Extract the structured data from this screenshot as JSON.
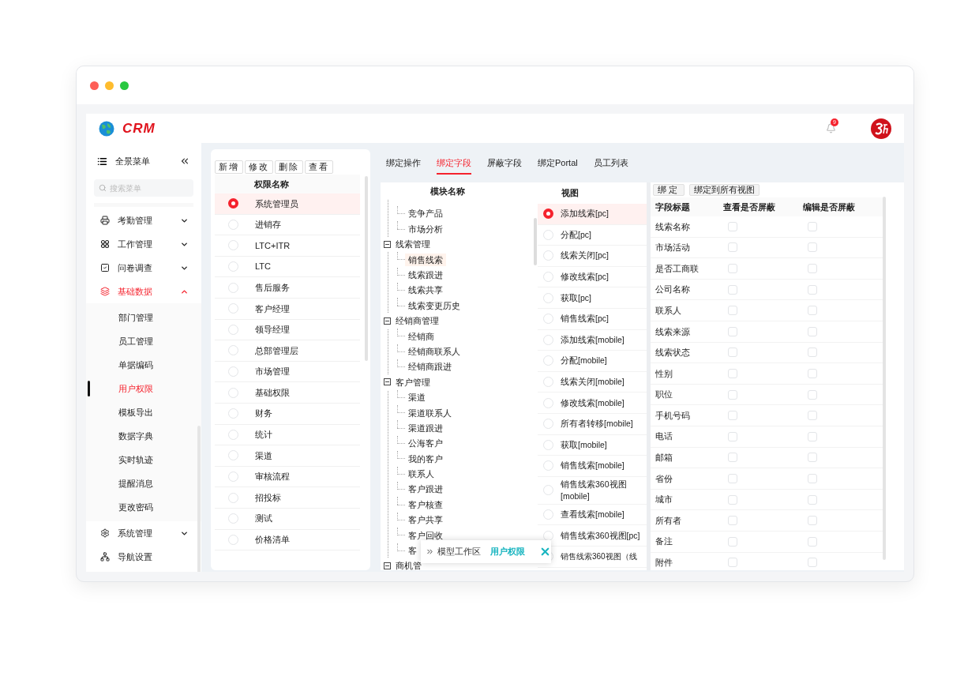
{
  "app": {
    "logo": "CRM",
    "notification_count": "9"
  },
  "sidebar": {
    "title": "全景菜单",
    "search_placeholder": "搜索菜单",
    "items": [
      {
        "label": "考勤管理",
        "selected": false,
        "expanded": false
      },
      {
        "label": "工作管理",
        "selected": false,
        "expanded": false
      },
      {
        "label": "问卷调查",
        "selected": false,
        "expanded": false
      },
      {
        "label": "基础数据",
        "selected": true,
        "expanded": true,
        "children": [
          {
            "label": "部门管理",
            "selected": false
          },
          {
            "label": "员工管理",
            "selected": false
          },
          {
            "label": "单据编码",
            "selected": false
          },
          {
            "label": "用户权限",
            "selected": true
          },
          {
            "label": "模板导出",
            "selected": false
          },
          {
            "label": "数据字典",
            "selected": false
          },
          {
            "label": "实时轨迹",
            "selected": false
          },
          {
            "label": "提醒消息",
            "selected": false
          },
          {
            "label": "更改密码",
            "selected": false
          }
        ]
      },
      {
        "label": "系统管理",
        "selected": false,
        "expanded": false
      },
      {
        "label": "导航设置",
        "selected": false
      }
    ]
  },
  "roles": {
    "buttons": [
      "新增",
      "修改",
      "删除",
      "查看"
    ],
    "column": "权限名称",
    "rows": [
      {
        "name": "系统管理员",
        "selected": true
      },
      {
        "name": "进销存",
        "selected": false
      },
      {
        "name": "LTC+ITR",
        "selected": false
      },
      {
        "name": "LTC",
        "selected": false
      },
      {
        "name": "售后服务",
        "selected": false
      },
      {
        "name": "客户经理",
        "selected": false
      },
      {
        "name": "领导经理",
        "selected": false
      },
      {
        "name": "总部管理层",
        "selected": false
      },
      {
        "name": "市场管理",
        "selected": false
      },
      {
        "name": "基础权限",
        "selected": false
      },
      {
        "name": "财务",
        "selected": false
      },
      {
        "name": "统计",
        "selected": false
      },
      {
        "name": "渠道",
        "selected": false
      },
      {
        "name": "审核流程",
        "selected": false
      },
      {
        "name": "招投标",
        "selected": false
      },
      {
        "name": "测试",
        "selected": false
      },
      {
        "name": "价格清单",
        "selected": false
      }
    ]
  },
  "tabs": [
    {
      "label": "绑定操作",
      "selected": false
    },
    {
      "label": "绑定字段",
      "selected": true
    },
    {
      "label": "屏蔽字段",
      "selected": false
    },
    {
      "label": "绑定Portal",
      "selected": false
    },
    {
      "label": "员工列表",
      "selected": false
    }
  ],
  "tree": {
    "column": "模块名称",
    "nodes": [
      {
        "children": [
          {
            "label": "竞争产品",
            "selected": false
          },
          {
            "label": "市场分析",
            "selected": false
          }
        ]
      },
      {
        "label": "线索管理",
        "expanded": true,
        "children": [
          {
            "label": "销售线索",
            "selected": true
          },
          {
            "label": "线索跟进",
            "selected": false
          },
          {
            "label": "线索共享",
            "selected": false
          },
          {
            "label": "线索变更历史",
            "selected": false
          }
        ]
      },
      {
        "label": "经销商管理",
        "expanded": true,
        "children": [
          {
            "label": "经销商",
            "selected": false
          },
          {
            "label": "经销商联系人",
            "selected": false
          },
          {
            "label": "经销商跟进",
            "selected": false
          }
        ]
      },
      {
        "label": "客户管理",
        "expanded": true,
        "children": [
          {
            "label": "渠道",
            "selected": false
          },
          {
            "label": "渠道联系人",
            "selected": false
          },
          {
            "label": "渠道跟进",
            "selected": false
          },
          {
            "label": "公海客户",
            "selected": false
          },
          {
            "label": "我的客户",
            "selected": false
          },
          {
            "label": "联系人",
            "selected": false
          },
          {
            "label": "客户跟进",
            "selected": false
          },
          {
            "label": "客户核查",
            "selected": false
          },
          {
            "label": "客户共享",
            "selected": false
          },
          {
            "label": "客户回收",
            "selected": false
          },
          {
            "label": "客",
            "selected": false
          }
        ]
      },
      {
        "label": "商机管",
        "expanded": true
      }
    ]
  },
  "views": {
    "column": "视图",
    "rows": [
      {
        "name": "添加线索[pc]",
        "selected": true
      },
      {
        "name": "分配[pc]",
        "selected": false
      },
      {
        "name": "线索关闭[pc]",
        "selected": false
      },
      {
        "name": "修改线索[pc]",
        "selected": false
      },
      {
        "name": "获取[pc]",
        "selected": false
      },
      {
        "name": "销售线索[pc]",
        "selected": false
      },
      {
        "name": "添加线索[mobile]",
        "selected": false
      },
      {
        "name": "分配[mobile]",
        "selected": false
      },
      {
        "name": "线索关闭[mobile]",
        "selected": false
      },
      {
        "name": "修改线索[mobile]",
        "selected": false
      },
      {
        "name": "所有者转移[mobile]",
        "selected": false
      },
      {
        "name": "获取[mobile]",
        "selected": false
      },
      {
        "name": "销售线索[mobile]",
        "selected": false
      },
      {
        "name": "销售线索360视图[mobile]",
        "selected": false
      },
      {
        "name": "查看线索[mobile]",
        "selected": false
      },
      {
        "name": "销售线索360视图[pc]",
        "selected": false
      },
      {
        "name": "销售线索360视图（线",
        "selected": false
      }
    ]
  },
  "fields": {
    "buttons": [
      "绑定",
      "绑定到所有视图"
    ],
    "columns": [
      "字段标题",
      "查看是否屏蔽",
      "编辑是否屏蔽"
    ],
    "rows": [
      {
        "title": "线索名称",
        "view_hidden": false,
        "edit_hidden": false
      },
      {
        "title": "市场活动",
        "view_hidden": false,
        "edit_hidden": false
      },
      {
        "title": "是否工商联",
        "view_hidden": false,
        "edit_hidden": false
      },
      {
        "title": "公司名称",
        "view_hidden": false,
        "edit_hidden": false
      },
      {
        "title": "联系人",
        "view_hidden": false,
        "edit_hidden": false
      },
      {
        "title": "线索来源",
        "view_hidden": false,
        "edit_hidden": false
      },
      {
        "title": "线索状态",
        "view_hidden": false,
        "edit_hidden": false
      },
      {
        "title": "性别",
        "view_hidden": false,
        "edit_hidden": false
      },
      {
        "title": "职位",
        "view_hidden": false,
        "edit_hidden": false
      },
      {
        "title": "手机号码",
        "view_hidden": false,
        "edit_hidden": false
      },
      {
        "title": "电话",
        "view_hidden": false,
        "edit_hidden": false
      },
      {
        "title": "邮箱",
        "view_hidden": false,
        "edit_hidden": false
      },
      {
        "title": "省份",
        "view_hidden": false,
        "edit_hidden": false
      },
      {
        "title": "城市",
        "view_hidden": false,
        "edit_hidden": false
      },
      {
        "title": "所有者",
        "view_hidden": false,
        "edit_hidden": false
      },
      {
        "title": "备注",
        "view_hidden": false,
        "edit_hidden": false
      },
      {
        "title": "附件",
        "view_hidden": false,
        "edit_hidden": false
      }
    ]
  },
  "popup": {
    "label": "模型工作区",
    "link": "用户权限"
  }
}
